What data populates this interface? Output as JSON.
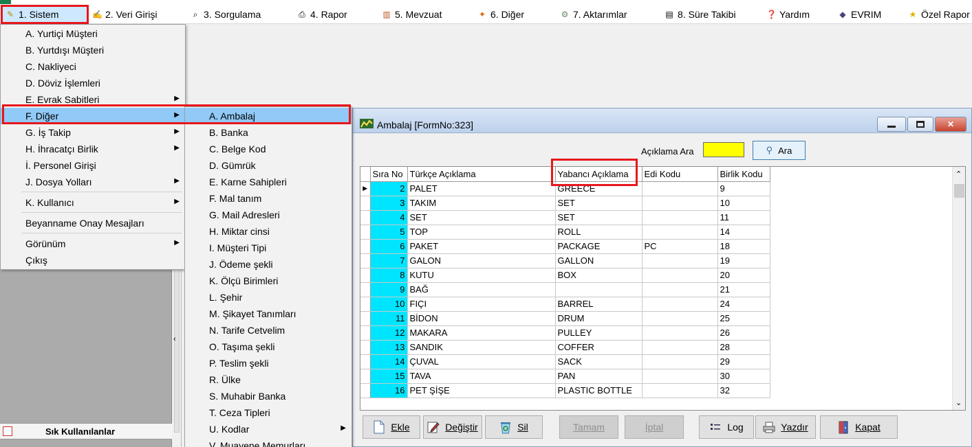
{
  "window_title": "",
  "menubar": [
    {
      "label": "1.  Sistem",
      "icon": "sistem-icon",
      "active": true
    },
    {
      "label": "2.  Veri Girişi",
      "icon": "veri-girisi-icon"
    },
    {
      "label": "3.  Sorgulama",
      "icon": "sorgulama-icon"
    },
    {
      "label": "4.  Rapor",
      "icon": "printer-icon"
    },
    {
      "label": "5.  Mevzuat",
      "icon": "books-icon"
    },
    {
      "label": "6.  Diğer",
      "icon": "diger-icon"
    },
    {
      "label": "7.  Aktarımlar",
      "icon": "gears-icon"
    },
    {
      "label": "8. Süre Takibi",
      "icon": "clipboard-icon"
    },
    {
      "label": "Yardım",
      "icon": "help-icon"
    },
    {
      "label": "EVRIM",
      "icon": "evrim-icon"
    },
    {
      "label": "Özel Rapor",
      "icon": "star-icon"
    }
  ],
  "sistem_menu": [
    {
      "label": "A.  Yurtiçi Müşteri"
    },
    {
      "label": "B.  Yurtdışı Müşteri"
    },
    {
      "label": "C.  Nakliyeci"
    },
    {
      "label": "D.  Döviz İşlemleri"
    },
    {
      "label": "E.  Evrak Sabitleri",
      "submenu": true
    },
    {
      "label": "F.  Diğer",
      "submenu": true,
      "highlighted": true
    },
    {
      "label": "G.  İş Takip",
      "submenu": true
    },
    {
      "label": "H.  İhracatçı Birlik",
      "submenu": true
    },
    {
      "label": "İ.   Personel Girişi"
    },
    {
      "label": "J.  Dosya Yolları",
      "submenu": true
    },
    {
      "label": "K.  Kullanıcı",
      "submenu": true
    },
    {
      "label": "Beyanname Onay Mesajları"
    },
    {
      "label": "Görünüm",
      "submenu": true
    },
    {
      "label": "Çıkış"
    }
  ],
  "diger_menu": [
    {
      "label": "A.  Ambalaj",
      "highlighted": true
    },
    {
      "label": "B.  Banka"
    },
    {
      "label": "C.  Belge Kod"
    },
    {
      "label": "D.  Gümrük"
    },
    {
      "label": "E.  Karne Sahipleri"
    },
    {
      "label": "F.  Mal tanım"
    },
    {
      "label": "G.  Mail Adresleri"
    },
    {
      "label": "H.  Miktar cinsi"
    },
    {
      "label": "I.  Müşteri Tipi"
    },
    {
      "label": "J.  Ödeme şekli"
    },
    {
      "label": "K.  Ölçü Birimleri"
    },
    {
      "label": "L.  Şehir"
    },
    {
      "label": "M.  Şikayet Tanımları"
    },
    {
      "label": "N.  Tarife Cetvelim"
    },
    {
      "label": "O.  Taşıma şekli"
    },
    {
      "label": "P.  Teslim şekli"
    },
    {
      "label": "R.  Ülke"
    },
    {
      "label": "S.  Muhabir Banka"
    },
    {
      "label": "T.  Ceza Tipleri"
    },
    {
      "label": "U. Kodlar",
      "submenu": true
    },
    {
      "label": "V. Muayene Memurları"
    }
  ],
  "left_panel": {
    "sik_kullanilanlar": "Sık Kullanılanlar"
  },
  "ambalaj_window": {
    "title": "Ambalaj [FormNo:323]",
    "search_label": "Açıklama Ara",
    "search_value": "",
    "search_button": "Ara",
    "columns": [
      "Sıra No",
      "Türkçe Açıklama",
      "Yabancı Açıklama",
      "Edi Kodu",
      "Birlik Kodu"
    ],
    "rows": [
      [
        "2",
        "PALET",
        "GREECE",
        "",
        "9"
      ],
      [
        "3",
        "TAKIM",
        "SET",
        "",
        "10"
      ],
      [
        "4",
        "SET",
        "SET",
        "",
        "11"
      ],
      [
        "5",
        "TOP",
        "ROLL",
        "",
        "14"
      ],
      [
        "6",
        "PAKET",
        "PACKAGE",
        "PC",
        "18"
      ],
      [
        "7",
        "GALON",
        "GALLON",
        "",
        "19"
      ],
      [
        "8",
        "KUTU",
        "BOX",
        "",
        "20"
      ],
      [
        "9",
        "BAĞ",
        "",
        "",
        "21"
      ],
      [
        "10",
        "FIÇI",
        "BARREL",
        "",
        "24"
      ],
      [
        "11",
        "BİDON",
        "DRUM",
        "",
        "25"
      ],
      [
        "12",
        "MAKARA",
        "PULLEY",
        "",
        "26"
      ],
      [
        "13",
        "SANDIK",
        "COFFER",
        "",
        "28"
      ],
      [
        "14",
        "ÇUVAL",
        "SACK",
        "",
        "29"
      ],
      [
        "15",
        "TAVA",
        "PAN",
        "",
        "30"
      ],
      [
        "16",
        "PET ŞİŞE",
        "PLASTIC BOTTLE",
        "",
        "32"
      ]
    ],
    "buttons": [
      {
        "label": "Ekle",
        "icon": "document-icon",
        "enabled": true
      },
      {
        "label": "Değiştir",
        "icon": "pencil-icon",
        "enabled": true
      },
      {
        "label": "Sil",
        "icon": "recycle-bin-icon",
        "enabled": true
      },
      {
        "label": "Tamam",
        "icon": "",
        "enabled": false
      },
      {
        "label": "İptal",
        "icon": "",
        "enabled": false
      },
      {
        "label": "Log",
        "icon": "list-icon",
        "enabled": true
      },
      {
        "label": "Yazdır",
        "icon": "printer-icon",
        "enabled": true
      },
      {
        "label": "Kapat",
        "icon": "door-icon",
        "enabled": true
      }
    ]
  },
  "colors": {
    "highlight_red": "#e8161b",
    "menu_hover": "#91c9f7",
    "sira_cyan": "#00e5ff",
    "search_yellow": "#ffff00"
  }
}
